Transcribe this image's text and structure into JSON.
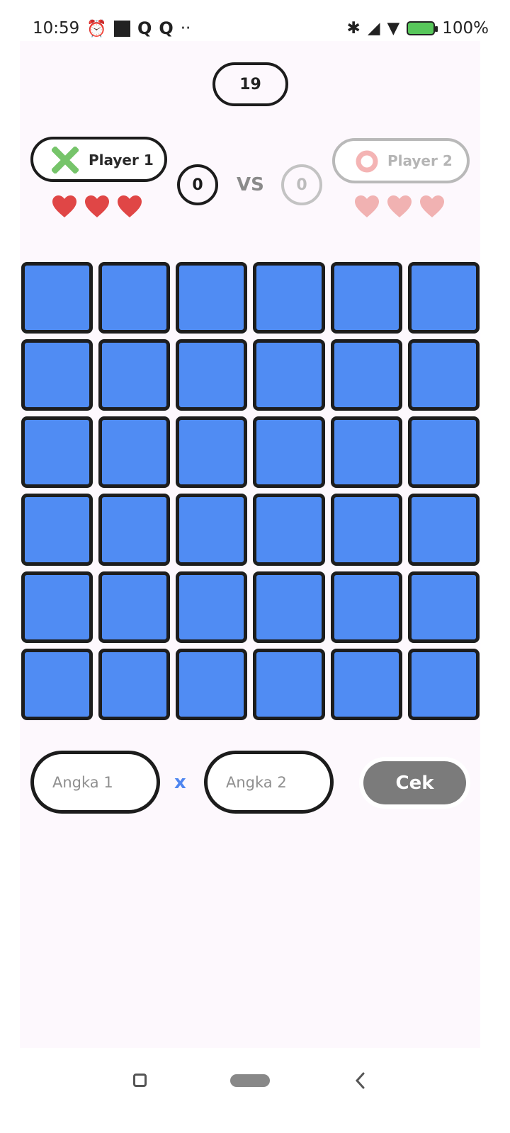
{
  "status_bar": {
    "time": "10:59",
    "left_icons": [
      "alarm-icon",
      "stop-icon",
      "q-app-icon",
      "q-app-icon",
      "more-dots-icon"
    ],
    "right_icons": [
      "bluetooth-icon",
      "signal-icon",
      "wifi-icon",
      "battery-charging-icon"
    ],
    "battery": "100%"
  },
  "game": {
    "timer": "19",
    "player1": {
      "name": "Player 1",
      "icon": "x-mark-icon",
      "score": "0",
      "lives": 3,
      "color": "#76c46a",
      "heart_color": "#e04646"
    },
    "player2": {
      "name": "Player 2",
      "icon": "circle-icon",
      "score": "0",
      "lives": 3,
      "color": "#f4b4b4",
      "heart_color": "#f1b2b2"
    },
    "vs_label": "VS",
    "grid": {
      "rows": 6,
      "cols": 6,
      "cell_color": "#508cf3"
    },
    "inputs": {
      "number1_placeholder": "Angka 1",
      "number2_placeholder": "Angka 2",
      "operator": "x",
      "check_label": "Cek"
    }
  },
  "nav": {
    "items": [
      "recents-icon",
      "home-pill-icon",
      "back-icon"
    ]
  }
}
